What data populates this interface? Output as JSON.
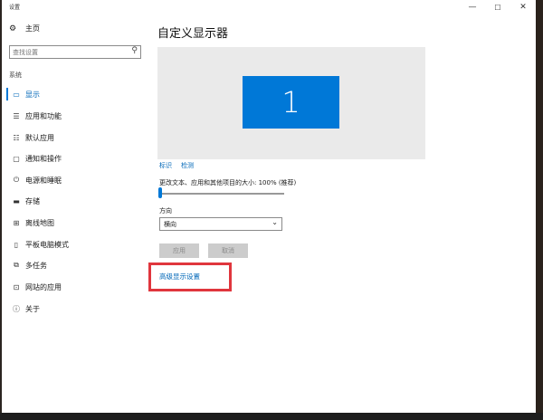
{
  "window": {
    "title": "设置",
    "controls": {
      "minimize": "—",
      "maximize": "☐",
      "close": "✕"
    }
  },
  "sidebar": {
    "home": {
      "label": "主页",
      "icon": "gear-icon"
    },
    "search": {
      "placeholder": "查找设置",
      "icon": "search-icon"
    },
    "section": "系统",
    "items": [
      {
        "label": "显示",
        "icon": "monitor-icon",
        "active": true
      },
      {
        "label": "应用和功能",
        "icon": "apps-list-icon"
      },
      {
        "label": "默认应用",
        "icon": "default-apps-icon"
      },
      {
        "label": "通知和操作",
        "icon": "notification-icon"
      },
      {
        "label": "电源和睡眠",
        "icon": "power-icon"
      },
      {
        "label": "存储",
        "icon": "storage-icon"
      },
      {
        "label": "离线地图",
        "icon": "map-icon"
      },
      {
        "label": "平板电脑模式",
        "icon": "tablet-icon"
      },
      {
        "label": "多任务",
        "icon": "multitask-icon"
      },
      {
        "label": "网站的应用",
        "icon": "web-apps-icon"
      },
      {
        "label": "关于",
        "icon": "info-icon"
      }
    ]
  },
  "main": {
    "title": "自定义显示器",
    "monitor_number": "1",
    "links": {
      "identify": "标识",
      "detect": "检测"
    },
    "scale_label": "更改文本、应用和其他项目的大小: 100% (推荐)",
    "scale_percent": 100,
    "orientation_label": "方向",
    "orientation_value": "横向",
    "apply_button": "应用",
    "cancel_button": "取消",
    "advanced_link": "高级显示设置"
  },
  "colors": {
    "accent": "#0078d7",
    "highlight": "#e0363d"
  }
}
